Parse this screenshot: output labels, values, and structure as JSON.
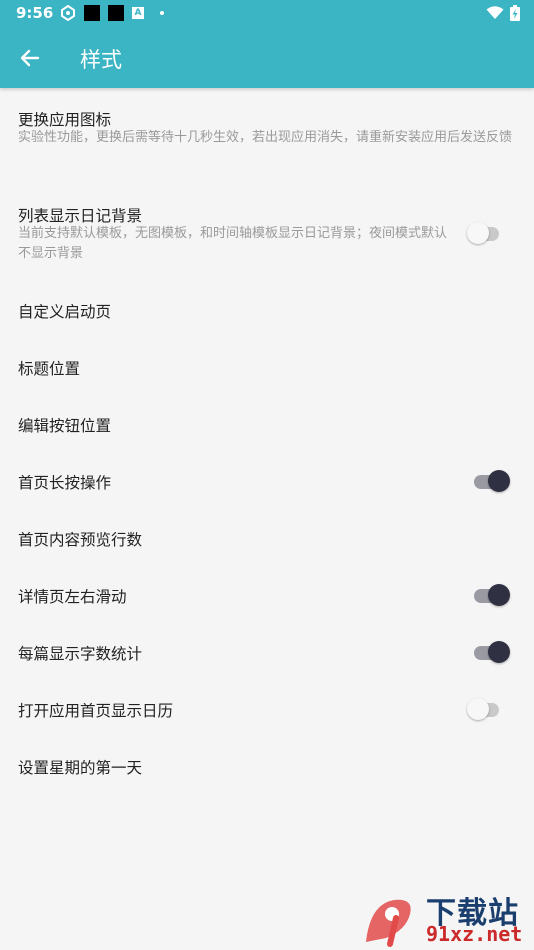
{
  "status": {
    "time": "9:56",
    "a_badge": "A"
  },
  "appbar": {
    "title": "样式"
  },
  "items": [
    {
      "title": "更换应用图标",
      "subtitle": "实验性功能，更换后需等待十几秒生效，若出现应用消失，请重新安装应用后发送反馈"
    },
    {
      "title": "列表显示日记背景",
      "subtitle": "当前支持默认模板，无图模板，和时间轴模板显示日记背景；夜间模式默认不显示背景",
      "switch_on": false
    },
    {
      "title": "自定义启动页"
    },
    {
      "title": "标题位置"
    },
    {
      "title": "编辑按钮位置"
    },
    {
      "title": "首页长按操作",
      "switch_on": true
    },
    {
      "title": "首页内容预览行数"
    },
    {
      "title": "详情页左右滑动",
      "switch_on": true
    },
    {
      "title": "每篇显示字数统计",
      "switch_on": true
    },
    {
      "title": "打开应用首页显示日历",
      "switch_on": false
    },
    {
      "title": "设置星期的第一天"
    }
  ],
  "watermark": {
    "text_cn": "下载站",
    "text_url": "91xz.net"
  },
  "colors": {
    "primary": "#3bb4c4",
    "switch_on_thumb": "#2f3042",
    "background": "#f5f5f5"
  }
}
